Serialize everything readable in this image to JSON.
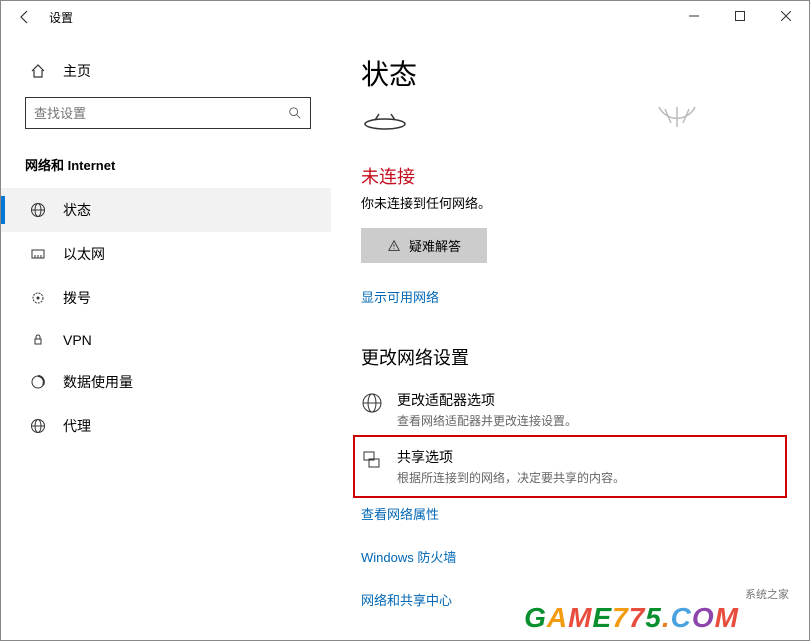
{
  "titlebar": {
    "title": "设置"
  },
  "sidebar": {
    "home": "主页",
    "search_placeholder": "查找设置",
    "section": "网络和 Internet",
    "items": [
      {
        "label": "状态"
      },
      {
        "label": "以太网"
      },
      {
        "label": "拨号"
      },
      {
        "label": "VPN"
      },
      {
        "label": "数据使用量"
      },
      {
        "label": "代理"
      }
    ]
  },
  "main": {
    "title": "状态",
    "not_connected": "未连接",
    "not_connected_sub": "你未连接到任何网络。",
    "troubleshoot": "疑难解答",
    "show_networks": "显示可用网络",
    "change_heading": "更改网络设置",
    "adapter": {
      "title": "更改适配器选项",
      "sub": "查看网络适配器并更改连接设置。"
    },
    "sharing": {
      "title": "共享选项",
      "sub": "根据所连接到的网络，决定要共享的内容。"
    },
    "links": {
      "props": "查看网络属性",
      "firewall": "Windows 防火墙",
      "center": "网络和共享中心"
    }
  },
  "watermark_tag": "系统之家"
}
